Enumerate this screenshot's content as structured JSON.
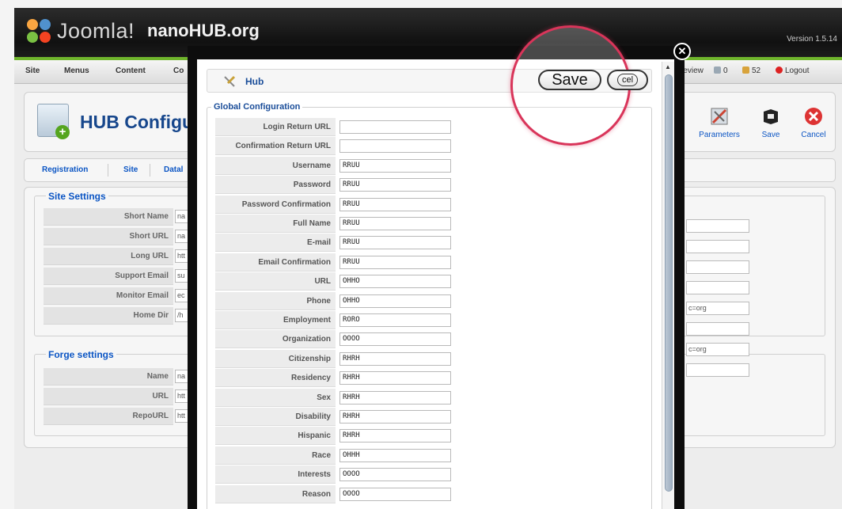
{
  "app": {
    "logo_text": "Joomla!",
    "site_name": "nanoHUB.org",
    "version": "Version 1.5.14"
  },
  "menu": {
    "items": [
      "Site",
      "Menus",
      "Content",
      "Co"
    ],
    "preview": "review",
    "visitors_count": "0",
    "messages_count": "52",
    "logout": "Logout"
  },
  "page": {
    "title": "HUB Configu",
    "toolbar": {
      "parameters": "Parameters",
      "save": "Save",
      "cancel": "Cancel"
    }
  },
  "tabs": [
    "Registration",
    "Site",
    "Datal"
  ],
  "site_settings": {
    "legend": "Site Settings",
    "rows": [
      {
        "label": "Short Name",
        "value": "na"
      },
      {
        "label": "Short URL",
        "value": "na"
      },
      {
        "label": "Long URL",
        "value": "htt"
      },
      {
        "label": "Support Email",
        "value": "su"
      },
      {
        "label": "Monitor Email",
        "value": "ec"
      },
      {
        "label": "Home Dir",
        "value": "/h"
      }
    ]
  },
  "forge_settings": {
    "legend": "Forge settings",
    "rows": [
      {
        "label": "Name",
        "value": "na"
      },
      {
        "label": "URL",
        "value": "htt"
      },
      {
        "label": "RepoURL",
        "value": "htt"
      }
    ]
  },
  "right_column_values": [
    "",
    "",
    "",
    "",
    "c=org",
    "",
    "c=org",
    ""
  ],
  "modal": {
    "title": "Hub",
    "save_label": "Save",
    "cancel_label": "cel",
    "close_symbol": "✕",
    "legend": "Global Configuration",
    "fields": [
      {
        "label": "Login Return URL",
        "value": ""
      },
      {
        "label": "Confirmation Return URL",
        "value": ""
      },
      {
        "label": "Username",
        "value": "RRUU"
      },
      {
        "label": "Password",
        "value": "RRUU"
      },
      {
        "label": "Password Confirmation",
        "value": "RRUU"
      },
      {
        "label": "Full Name",
        "value": "RRUU"
      },
      {
        "label": "E-mail",
        "value": "RRUU"
      },
      {
        "label": "Email Confirmation",
        "value": "RRUU"
      },
      {
        "label": "URL",
        "value": "OHHO"
      },
      {
        "label": "Phone",
        "value": "OHHO"
      },
      {
        "label": "Employment",
        "value": "RORO"
      },
      {
        "label": "Organization",
        "value": "OOOO"
      },
      {
        "label": "Citizenship",
        "value": "RHRH"
      },
      {
        "label": "Residency",
        "value": "RHRH"
      },
      {
        "label": "Sex",
        "value": "RHRH"
      },
      {
        "label": "Disability",
        "value": "RHRH"
      },
      {
        "label": "Hispanic",
        "value": "RHRH"
      },
      {
        "label": "Race",
        "value": "OHHH"
      },
      {
        "label": "Interests",
        "value": "OOOO"
      },
      {
        "label": "Reason",
        "value": "OOOO"
      }
    ]
  },
  "colors": {
    "accent_green": "#6fb52c",
    "link_blue": "#0b55c4",
    "highlight_ring": "#d9355a"
  }
}
